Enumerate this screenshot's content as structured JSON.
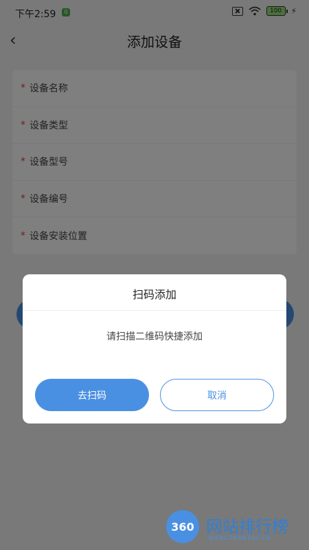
{
  "status_bar": {
    "time": "下午2:59",
    "notification_badge": "0",
    "battery": "100"
  },
  "header": {
    "title": "添加设备"
  },
  "form": {
    "required_mark": "*",
    "fields": [
      {
        "label": "设备名称"
      },
      {
        "label": "设备类型"
      },
      {
        "label": "设备型号"
      },
      {
        "label": "设备编号"
      },
      {
        "label": "设备安装位置"
      }
    ]
  },
  "dialog": {
    "title": "扫码添加",
    "message": "请扫描二维码快捷添加",
    "scan_button": "去扫码",
    "cancel_button": "取消"
  },
  "watermark": {
    "logo_number": "360",
    "text": "网站排行榜",
    "subtext": "-WANGZHAN360.CN-"
  },
  "colors": {
    "accent": "#4a90e2",
    "required": "#e53935"
  }
}
